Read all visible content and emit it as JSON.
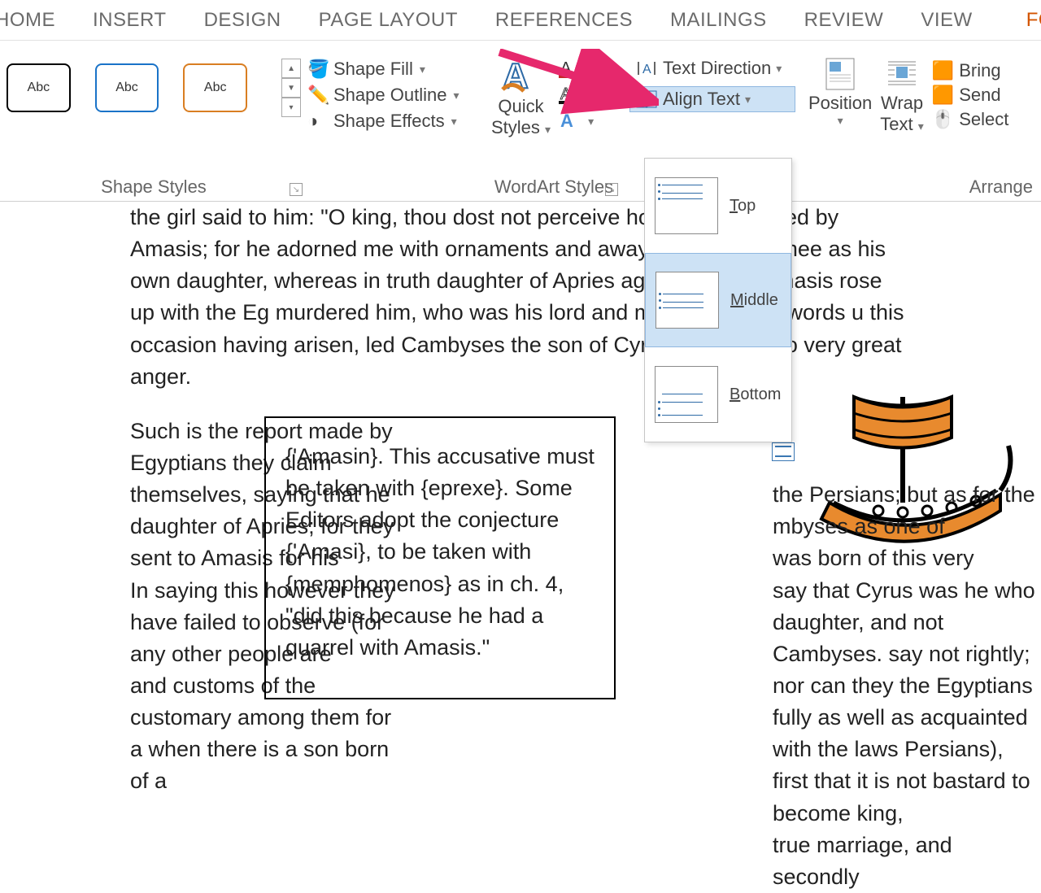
{
  "ribbon_tabs": [
    "HOME",
    "INSERT",
    "DESIGN",
    "PAGE LAYOUT",
    "REFERENCES",
    "MAILINGS",
    "REVIEW",
    "VIEW",
    "FORMAT"
  ],
  "shapes": {
    "gallery_label": "Abc",
    "group_label": "Shape Styles"
  },
  "shape_tools": {
    "fill": "Shape Fill",
    "outline": "Shape Outline",
    "effects": "Shape Effects"
  },
  "wordart": {
    "quick": "Quick",
    "styles": "Styles",
    "group_label": "WordArt Styles"
  },
  "textgrp": {
    "direction": "Text Direction",
    "align": "Align Text",
    "dd": {
      "top": "Top",
      "mid": "Middle",
      "bot": "Bottom"
    }
  },
  "arrange": {
    "position": "Position",
    "wrap": "Wrap",
    "text": "Text",
    "bring": "Bring",
    "send": "Send",
    "select": "Select",
    "group_label": "Arrange"
  },
  "doc": {
    "p1": "the girl said to him: \"O king, thou dost not perceive how thou deceived by Amasis; for he adorned me with ornaments and away giving me to thee as his own daughter, whereas in truth daughter of Apries against whom Amasis rose up with the Eg murdered him, who was his lord and master.\" These words u this occasion having arisen, led Cambyses the son of Cyrus ag moved to very great anger.",
    "left": "Such is the report made by Egyptians they claim themselves, saying that he daughter of Apries; for they sent to Amasis for his\nIn saying this however they have failed to observe (for any other people are\nand customs of the\ncustomary among them for a when there is a son born of a",
    "right": "the Persians; but as for the\n        mbyses as one of\nwas born of this very\nsay that Cyrus was he who daughter, and not Cambyses. say not rightly; nor can they the Egyptians fully as well as acquainted with the laws Persians), first that it is not bastard to become king,\ntrue marriage, and secondly",
    "box": "{'Amasin}. This accusative must be taken with {eprexe}. Some Editors adopt the conjecture {'Amasi}, to be taken with {memphomenos} as in ch. 4, \"did this because he had a quarrel with Amasis.\""
  }
}
